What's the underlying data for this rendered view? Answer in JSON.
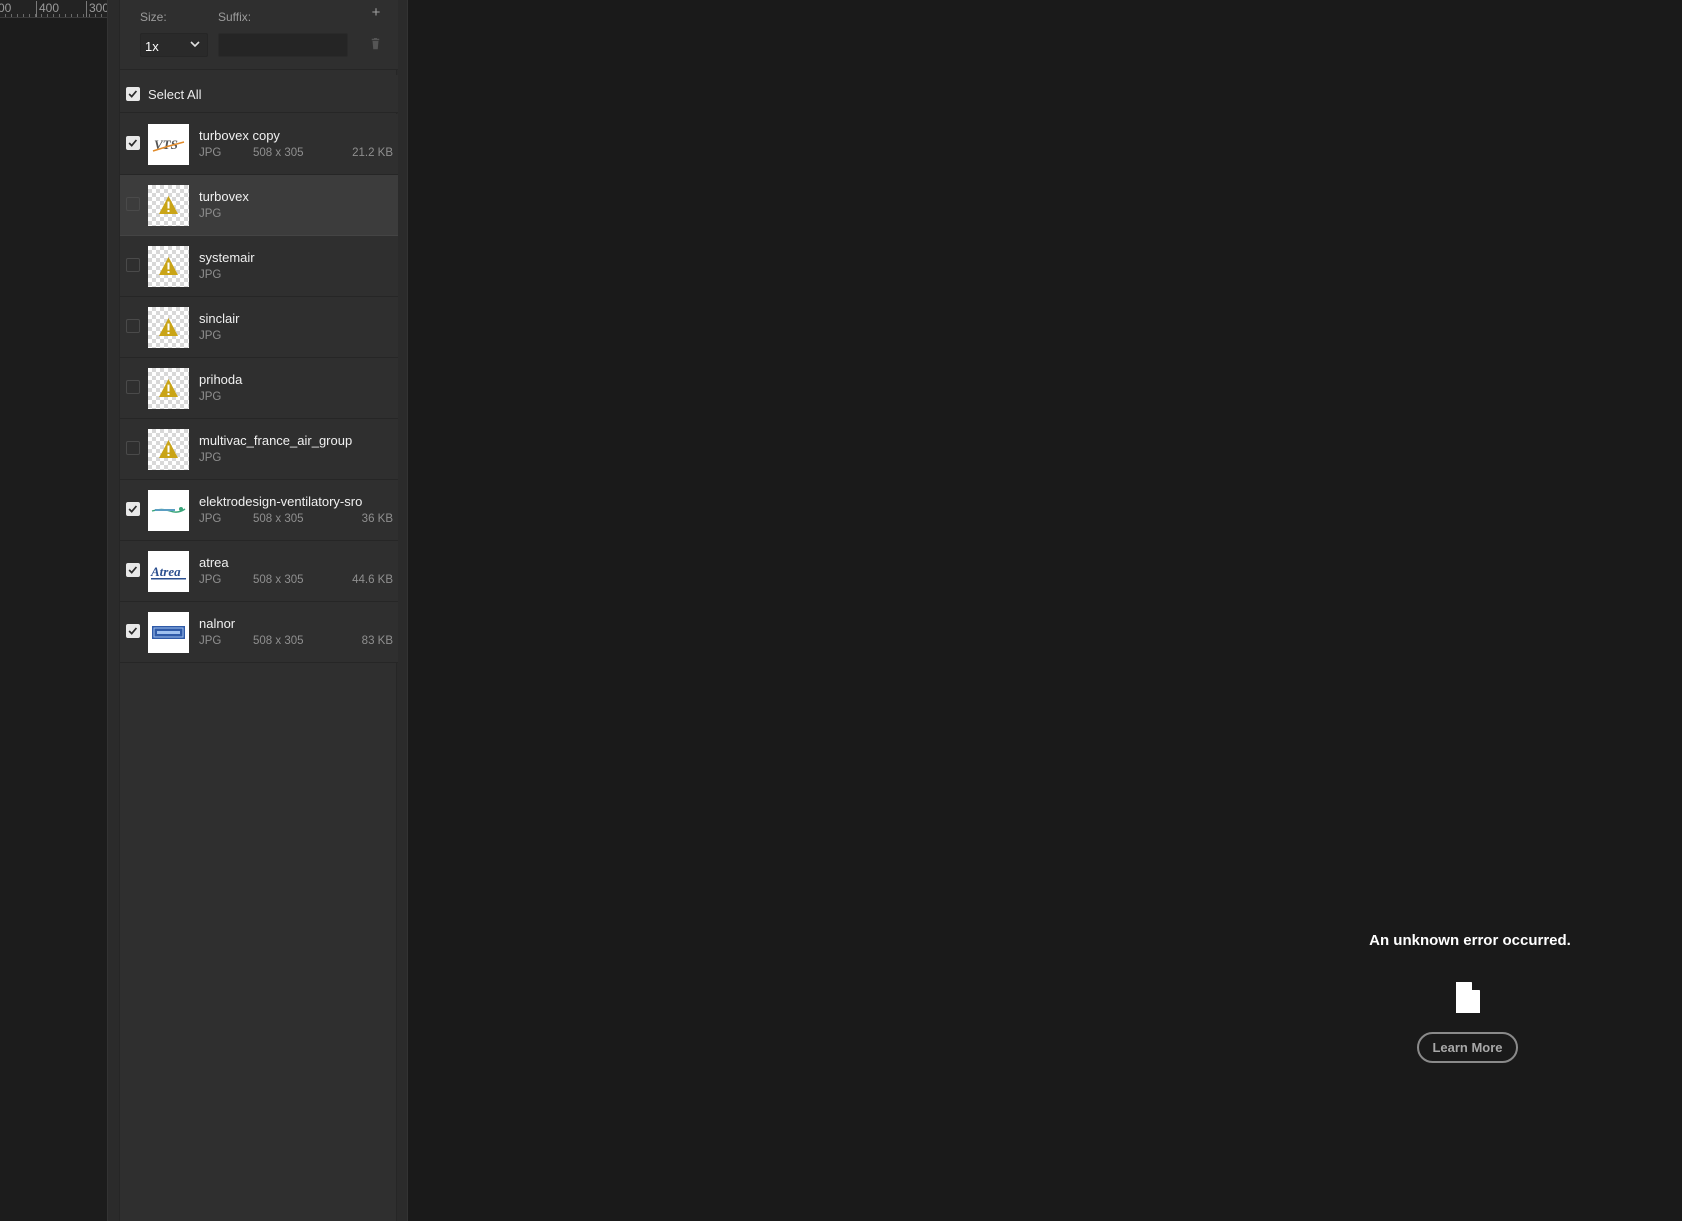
{
  "ruler": {
    "labels": [
      "00",
      "400",
      "300"
    ]
  },
  "size_section": {
    "size_label": "Size:",
    "suffix_label": "Suffix:",
    "size_value": "1x",
    "suffix_value": "",
    "add_icon": "plus-icon",
    "delete_icon": "trash-icon"
  },
  "select_all": {
    "label": "Select All",
    "checked": true
  },
  "assets": [
    {
      "name": "turbovex copy",
      "type": "JPG",
      "dims": "508 x 305",
      "size": "21.2 KB",
      "checked": true,
      "thumb": "vts-logo"
    },
    {
      "name": "turbovex",
      "type": "JPG",
      "dims": "",
      "size": "",
      "checked": false,
      "thumb": "warning-icon"
    },
    {
      "name": "systemair",
      "type": "JPG",
      "dims": "",
      "size": "",
      "checked": false,
      "thumb": "warning-icon"
    },
    {
      "name": "sinclair",
      "type": "JPG",
      "dims": "",
      "size": "",
      "checked": false,
      "thumb": "warning-icon"
    },
    {
      "name": "prihoda",
      "type": "JPG",
      "dims": "",
      "size": "",
      "checked": false,
      "thumb": "warning-icon"
    },
    {
      "name": "multivac_france_air_group",
      "type": "JPG",
      "dims": "",
      "size": "",
      "checked": false,
      "thumb": "warning-icon"
    },
    {
      "name": "elektrodesign-ventilatory-sro",
      "type": "JPG",
      "dims": "508 x 305",
      "size": "36 KB",
      "checked": true,
      "thumb": "elektrodesign-logo"
    },
    {
      "name": "atrea",
      "type": "JPG",
      "dims": "508 x 305",
      "size": "44.6 KB",
      "checked": true,
      "thumb": "atrea-logo"
    },
    {
      "name": "nalnor",
      "type": "JPG",
      "dims": "508 x 305",
      "size": "83 KB",
      "checked": true,
      "thumb": "nalnor-logo"
    }
  ],
  "selected_index": 1,
  "error": {
    "message": "An unknown error occurred.",
    "icon": "document-icon",
    "learn_more": "Learn More"
  },
  "colors": {
    "background": "#1a1a1a",
    "panel": "#2f2f2f",
    "selected_row": "#3c3c3c",
    "warning": "#d4b106"
  }
}
